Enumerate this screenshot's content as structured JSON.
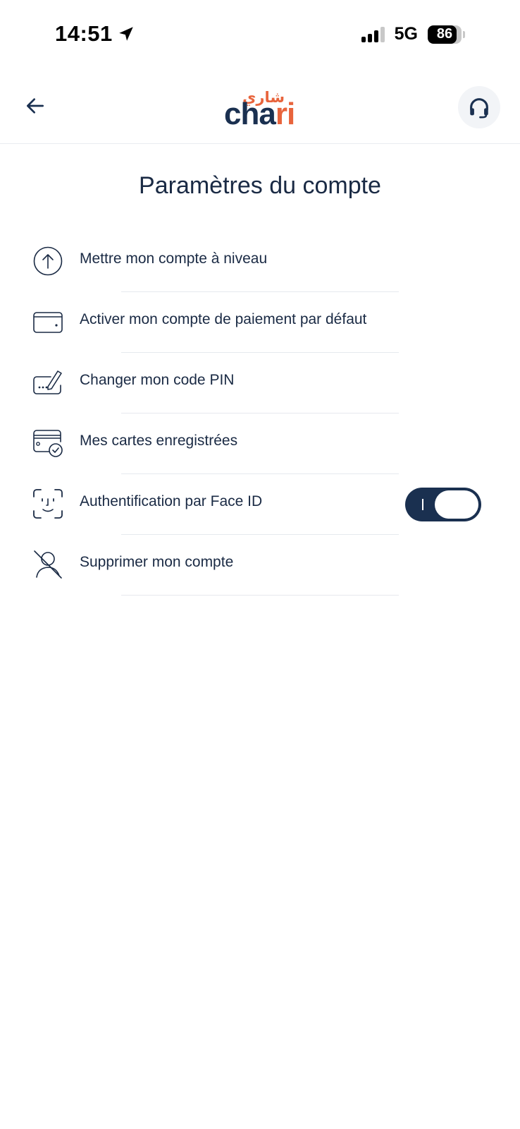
{
  "status_bar": {
    "time": "14:51",
    "network": "5G",
    "battery": "86",
    "battery_level_percent": 86,
    "signal_bars_active": 3,
    "signal_bars_total": 4,
    "icons": [
      "location-arrow-icon",
      "signal-icon",
      "battery-icon"
    ]
  },
  "header": {
    "back_icon": "arrow-left-icon",
    "logo_arabic": "شاري",
    "logo_latin_main": "cha",
    "logo_latin_accent": "ri",
    "support_icon": "headset-icon"
  },
  "page": {
    "title": "Paramètres du compte"
  },
  "menu": {
    "items": [
      {
        "label": "Mettre mon compte à niveau",
        "icon": "arrow-up-circle-icon"
      },
      {
        "label": "Activer mon compte de paiement par défaut",
        "icon": "wallet-icon"
      },
      {
        "label": "Changer mon code PIN",
        "icon": "pin-edit-icon"
      },
      {
        "label": "Mes cartes enregistrées",
        "icon": "card-check-icon"
      },
      {
        "label": "Authentification par Face ID",
        "icon": "face-id-icon",
        "toggle_on": true
      },
      {
        "label": "Supprimer mon compte",
        "icon": "user-remove-icon"
      }
    ]
  },
  "colors": {
    "primary": "#1a3050",
    "accent": "#e8643c",
    "text": "#1a2a44",
    "divider": "#e6e9ee"
  }
}
